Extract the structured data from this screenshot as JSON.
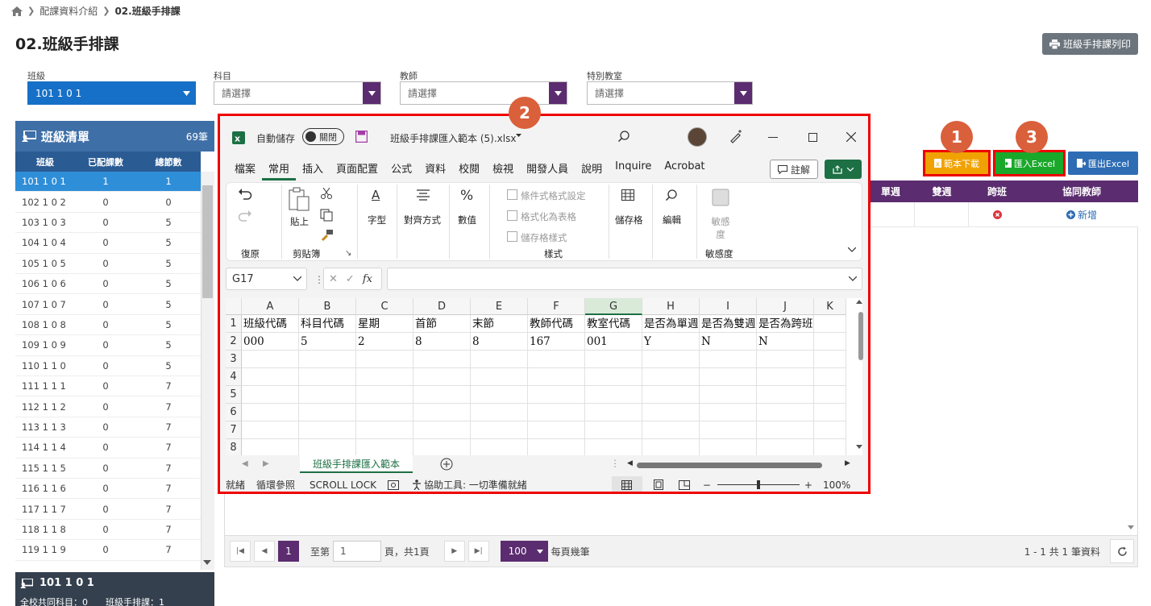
{
  "breadcrumb": {
    "items": [
      "配課資料介紹",
      "02.班級手排課"
    ]
  },
  "page": {
    "title": "02.班級手排課",
    "print_label": "班級手排課列印"
  },
  "filters": {
    "class_label": "班級",
    "class_value": "101 1 0 1",
    "subject_label": "科目",
    "subject_placeholder": "請選擇",
    "teacher_label": "教師",
    "teacher_placeholder": "請選擇",
    "room_label": "特別教室",
    "room_placeholder": "請選擇"
  },
  "class_list": {
    "title": "班級清單",
    "count": "69筆",
    "columns": [
      "班級",
      "已配課數",
      "總節數"
    ],
    "rows": [
      [
        "101 1 0 1",
        "1",
        "1"
      ],
      [
        "102 1 0 2",
        "0",
        "0"
      ],
      [
        "103 1 0 3",
        "0",
        "5"
      ],
      [
        "104 1 0 4",
        "0",
        "5"
      ],
      [
        "105 1 0 5",
        "0",
        "5"
      ],
      [
        "106 1 0 6",
        "0",
        "5"
      ],
      [
        "107 1 0 7",
        "0",
        "5"
      ],
      [
        "108 1 0 8",
        "0",
        "5"
      ],
      [
        "109 1 0 9",
        "0",
        "5"
      ],
      [
        "110 1 1 0",
        "0",
        "5"
      ],
      [
        "111 1 1 1",
        "0",
        "7"
      ],
      [
        "112 1 1 2",
        "0",
        "7"
      ],
      [
        "113 1 1 3",
        "0",
        "7"
      ],
      [
        "114 1 1 4",
        "0",
        "7"
      ],
      [
        "115 1 1 5",
        "0",
        "7"
      ],
      [
        "116 1 1 6",
        "0",
        "7"
      ],
      [
        "117 1 1 7",
        "0",
        "7"
      ],
      [
        "118 1 1 8",
        "0",
        "7"
      ],
      [
        "119 1 1 9",
        "0",
        "7"
      ]
    ],
    "footer_title": "101 1 0 1",
    "footer_line": "全校共同科目：0　　班級手排課：1"
  },
  "actions": {
    "template_label": "範本下載",
    "import_label": "匯入Excel",
    "export_label": "匯出Excel"
  },
  "table": {
    "columns": [
      "單週",
      "雙週",
      "跨班",
      "協同教師"
    ],
    "add_label": "新增"
  },
  "pager": {
    "page": "1",
    "goto_label": "至第",
    "goto_value": "1",
    "total_label": "頁，共1頁",
    "size": "100",
    "size_label": "每頁幾筆",
    "summary": "1 - 1 共 1 筆資料"
  },
  "badges": [
    "1",
    "2",
    "3"
  ],
  "excel": {
    "autosave_label": "自動儲存",
    "autosave_state": "關閉",
    "filename": "班級手排課匯入範本 (5).xlsx",
    "menu": [
      "檔案",
      "常用",
      "插入",
      "頁面配置",
      "公式",
      "資料",
      "校閱",
      "檢視",
      "開發人員",
      "說明",
      "Inquire",
      "Acrobat"
    ],
    "comments_label": "註解",
    "ribbon": {
      "undo": "復原",
      "paste": "貼上",
      "clipboard": "剪貼簿",
      "font": "字型",
      "align": "對齊方式",
      "number": "數值",
      "cond_format": "條件式格式設定",
      "format_table": "格式化為表格",
      "cell_styles": "儲存格樣式",
      "styles": "樣式",
      "cells": "儲存格",
      "editing": "編輯",
      "sensitivity": "敏感度",
      "sensitivity_btn": "敏感度"
    },
    "name_box": "G17",
    "columns": [
      "A",
      "B",
      "C",
      "D",
      "E",
      "F",
      "G",
      "H",
      "I",
      "J",
      "K"
    ],
    "rows": [
      "1",
      "2",
      "3",
      "4",
      "5",
      "6",
      "7",
      "8"
    ],
    "header_row": [
      "班級代碼",
      "科目代碼",
      "星期",
      "首節",
      "末節",
      "教師代碼",
      "教室代碼",
      "是否為單週",
      "是否為雙週",
      "是否為跨班"
    ],
    "data_row": [
      "000",
      "5",
      "2",
      "8",
      "8",
      "167",
      "001",
      "Y",
      "N",
      "N"
    ],
    "sheet_tab": "班級手排課匯入範本",
    "status": {
      "ready": "就緒",
      "circular": "循環參照",
      "scroll": "SCROLL LOCK",
      "accessibility": "協助工具: 一切準備就緒",
      "zoom": "100%"
    }
  },
  "colors": {
    "purple": "#5b2c6f",
    "blue": "#1670c7",
    "orange": "#f0a202",
    "green": "#1aa82b",
    "highlight": "#e00000"
  }
}
